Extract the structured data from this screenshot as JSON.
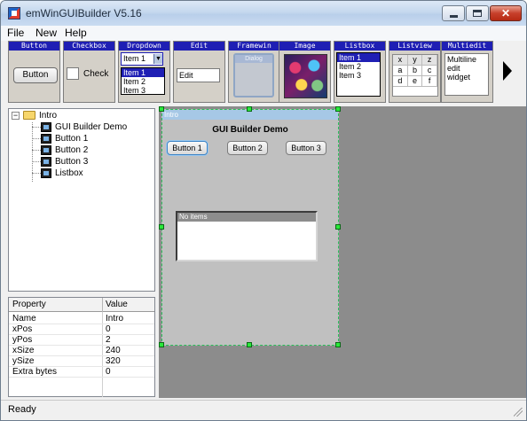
{
  "window": {
    "title": "emWinGUIBuilder V5.16"
  },
  "menu": [
    "File",
    "New",
    "Help"
  ],
  "toolbar": {
    "widgets": [
      {
        "header": "Button",
        "button_label": "Button"
      },
      {
        "header": "Checkbox",
        "check_label": "Check"
      },
      {
        "header": "Dropdown",
        "selected": "Item 1",
        "items": [
          "Item 1",
          "Item 2",
          "Item 3"
        ]
      },
      {
        "header": "Edit",
        "value": "Edit"
      },
      {
        "header": "Framewin",
        "frame_title": "Dialog"
      },
      {
        "header": "Image"
      },
      {
        "header": "Listbox",
        "items": [
          "Item 1",
          "Item 2",
          "Item 3"
        ]
      },
      {
        "header": "Listview",
        "columns": [
          "x",
          "y",
          "z"
        ],
        "rows": [
          [
            "a",
            "b",
            "c"
          ],
          [
            "d",
            "e",
            "f"
          ]
        ]
      },
      {
        "header": "Multiedit",
        "lines": [
          "Multiline",
          "edit",
          "widget"
        ]
      }
    ]
  },
  "tree": {
    "root": "Intro",
    "children": [
      "GUI Builder Demo",
      "Button 1",
      "Button 2",
      "Button 3",
      "Listbox"
    ]
  },
  "properties": {
    "headers": [
      "Property",
      "Value"
    ],
    "rows": [
      [
        "Name",
        "Intro"
      ],
      [
        "xPos",
        "0"
      ],
      [
        "yPos",
        "2"
      ],
      [
        "xSize",
        "240"
      ],
      [
        "ySize",
        "320"
      ],
      [
        "Extra bytes",
        "0"
      ]
    ]
  },
  "dialog": {
    "title": "Intro",
    "heading": "GUI Builder Demo",
    "buttons": [
      "Button 1",
      "Button 2",
      "Button 3"
    ],
    "listbox_text": "No items"
  },
  "status": "Ready"
}
